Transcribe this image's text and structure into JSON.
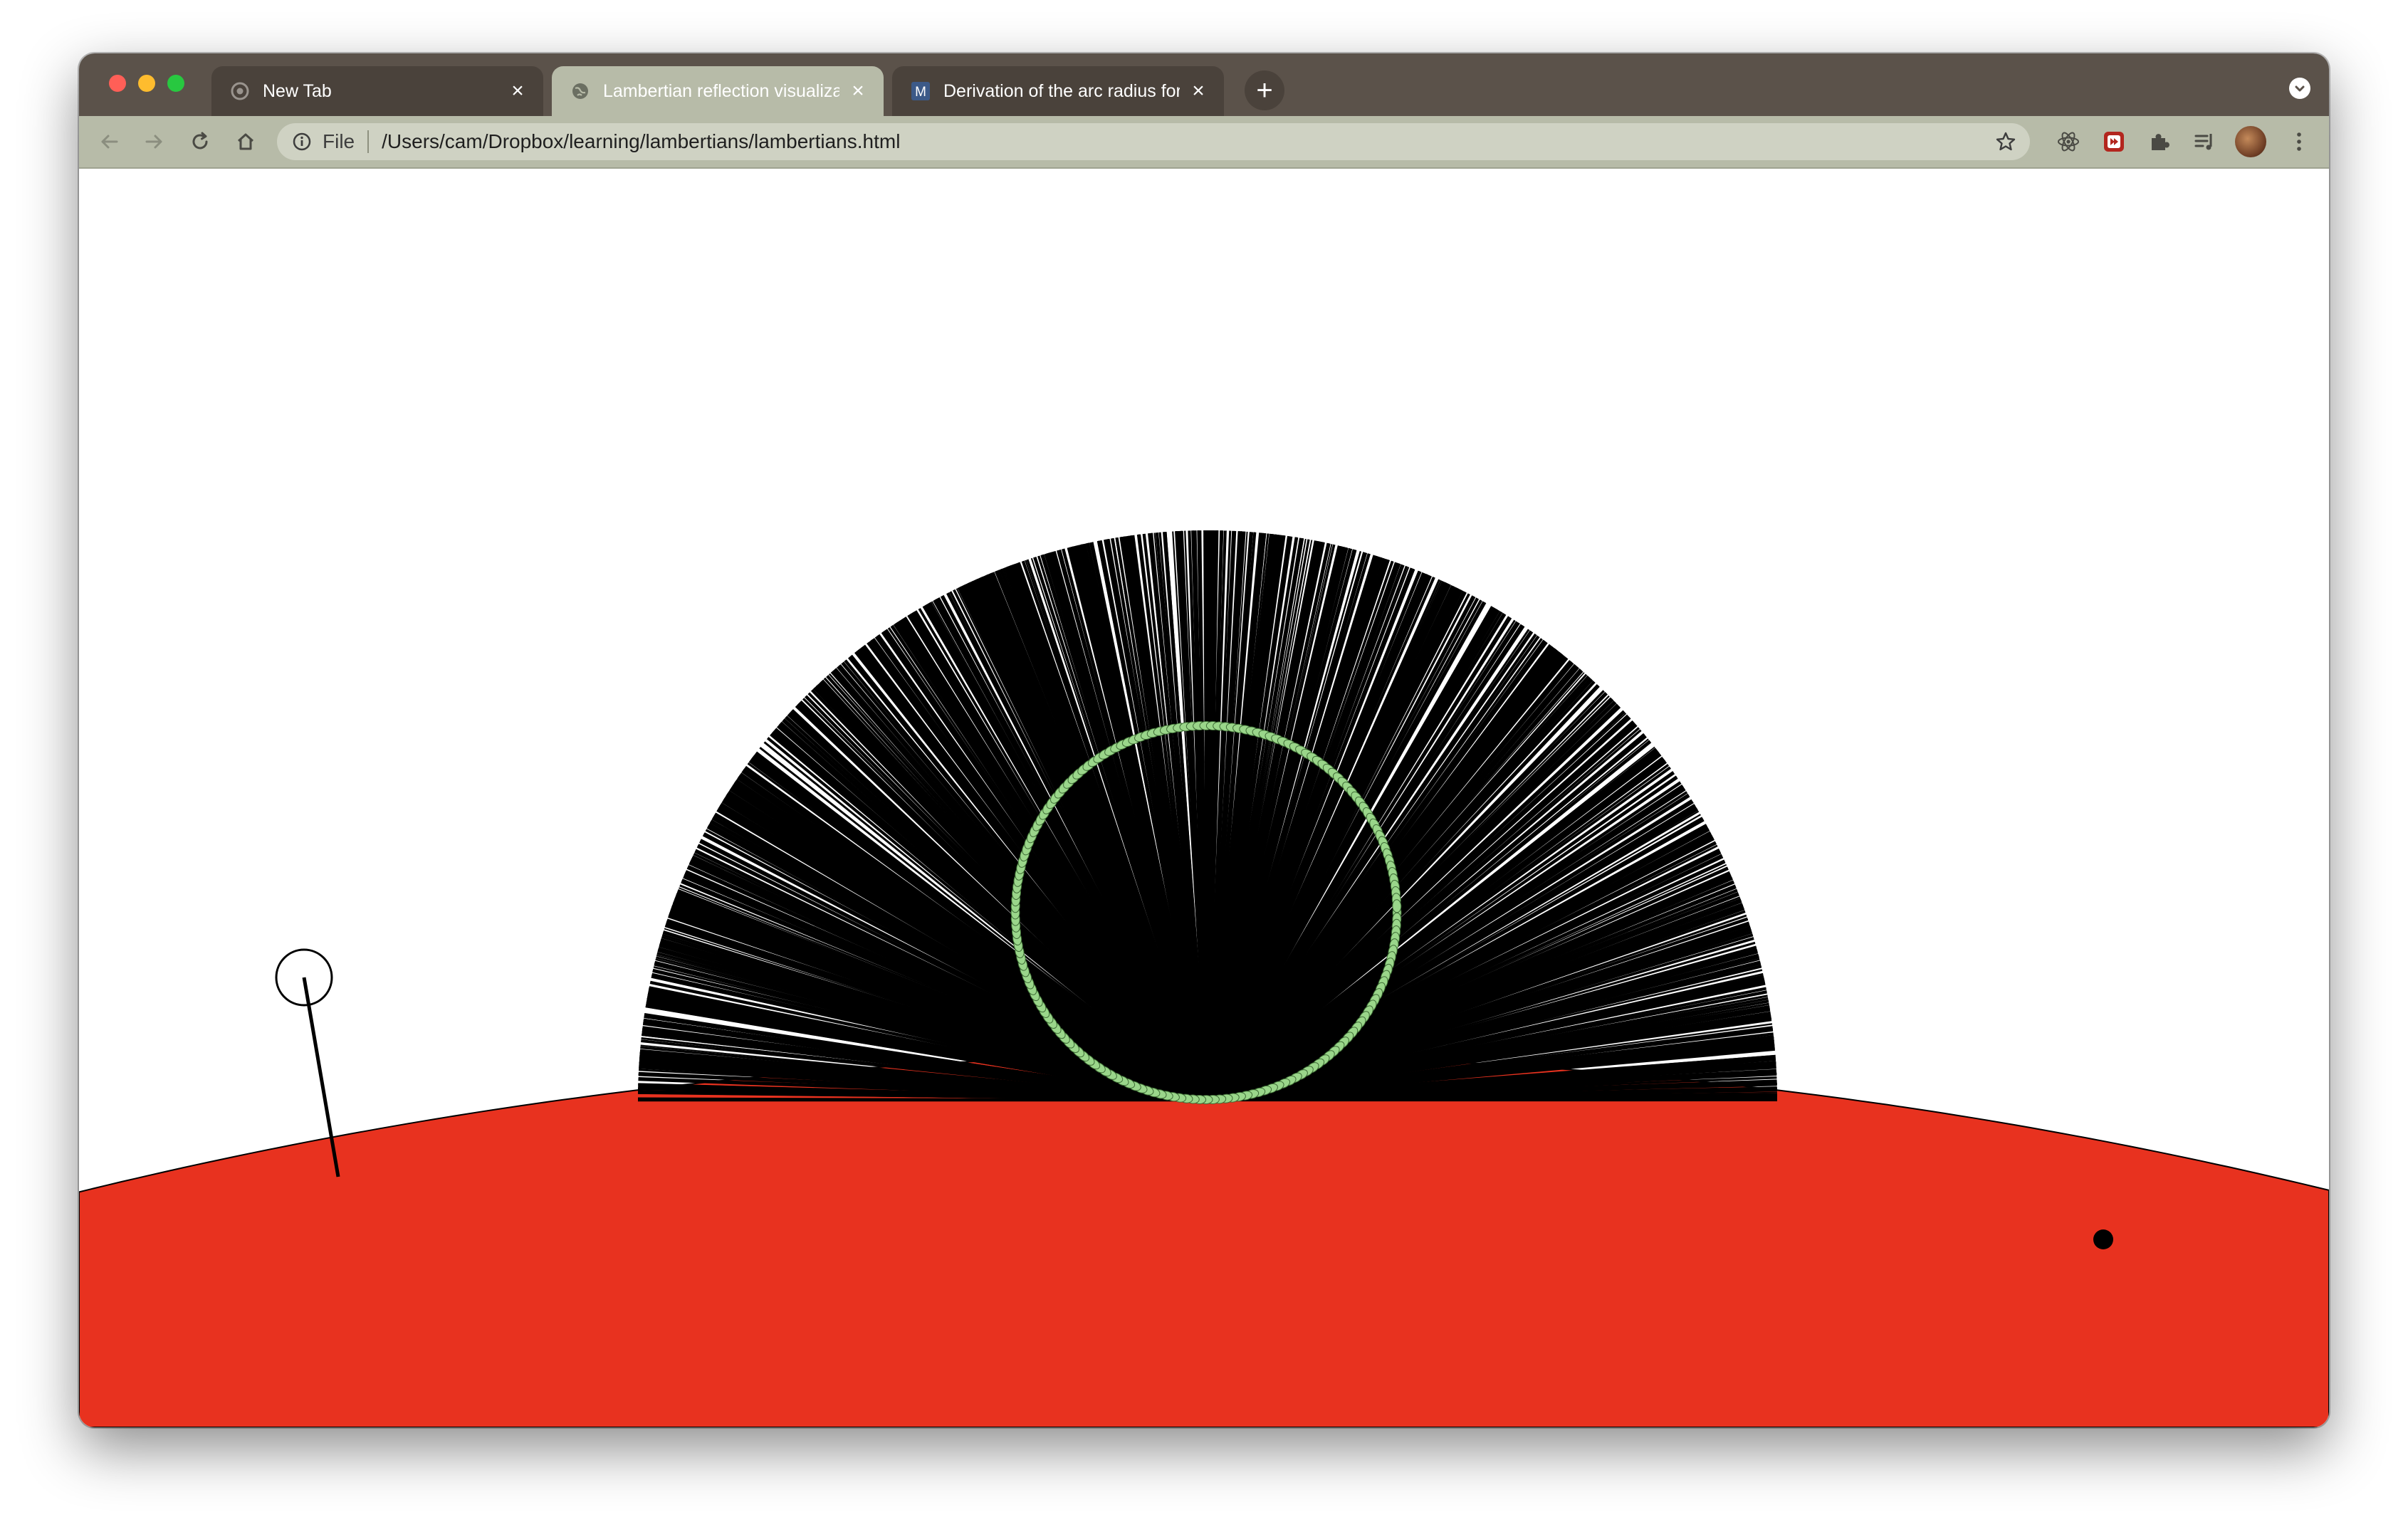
{
  "browser": {
    "tabs": [
      {
        "title": "New Tab",
        "favicon": "chrome-icon",
        "active": false
      },
      {
        "title": "Lambertian reflection visualization",
        "favicon": "globe-icon",
        "active": true
      },
      {
        "title": "Derivation of the arc radius formula",
        "favicon": "m-icon",
        "favicon_letter": "M",
        "active": false
      }
    ],
    "new_tab_symbol": "+",
    "close_symbol": "×",
    "address_bar": {
      "scheme_label": "File",
      "url": "/Users/cam/Dropbox/learning/lambertians/lambertians.html"
    },
    "extensions": [
      "react-devtools-icon",
      "video-extension-icon",
      "puzzle-icon",
      "reading-list-icon"
    ],
    "theme": {
      "tabstrip": "#5b524a",
      "toolbar": "#b7bba8"
    }
  },
  "scene": {
    "ground_color": "#e8321f",
    "ray_color": "#000000",
    "circle_color": "#9ad68a",
    "ray_count": 1400,
    "circle_dot_count": 180
  }
}
